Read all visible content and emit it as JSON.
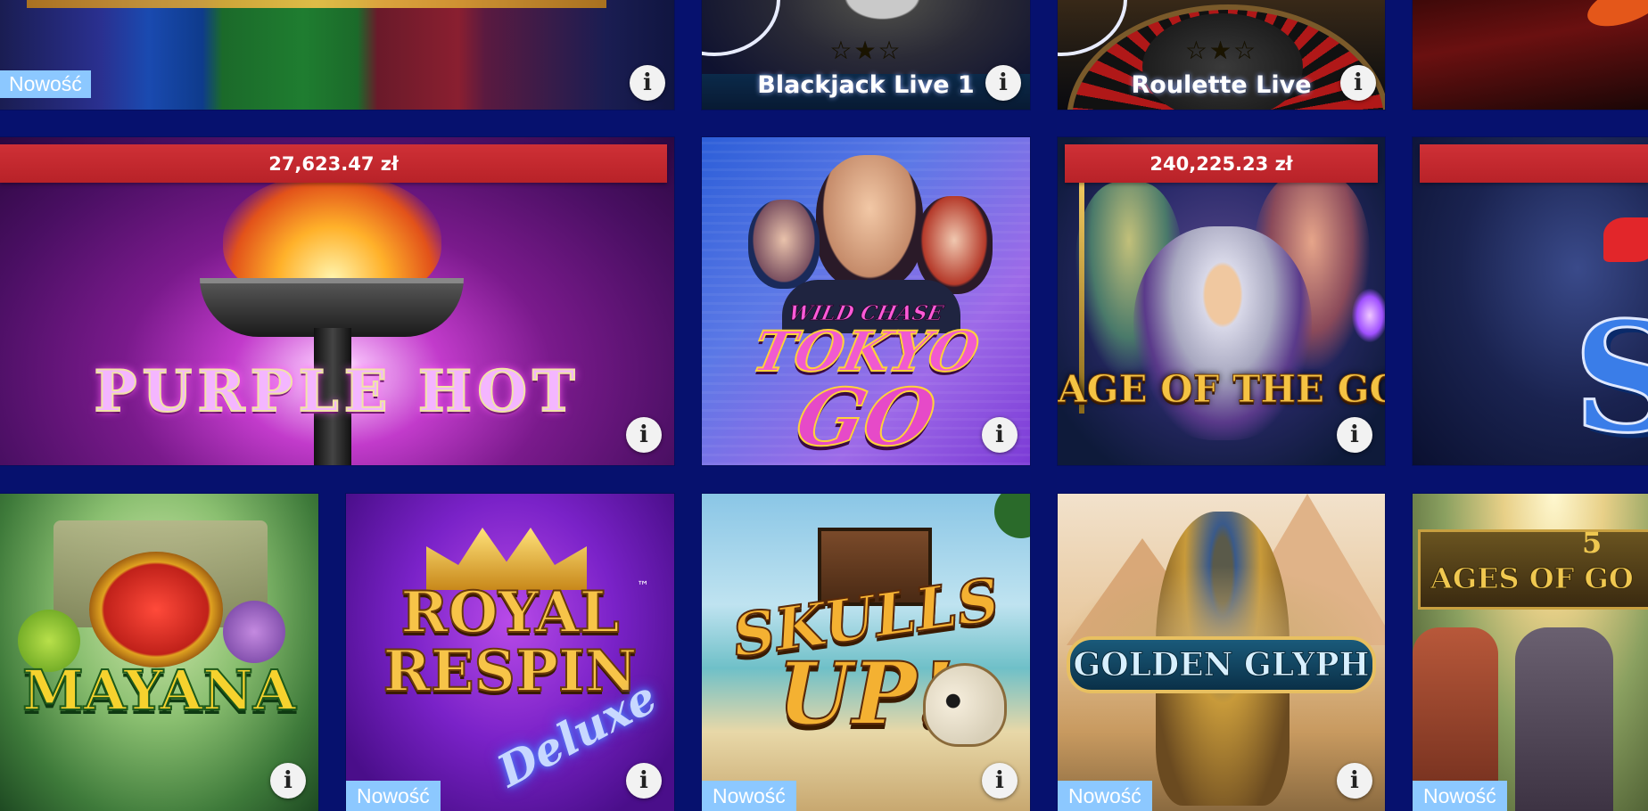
{
  "rows": {
    "top": {
      "tiles": [
        {
          "badge": "Nowość"
        },
        {
          "title": "Blackjack Live 1",
          "stars": "☆★☆"
        },
        {
          "title": "Roulette Live",
          "stars": "☆★☆"
        },
        {}
      ]
    },
    "middle": {
      "tiles": [
        {
          "jackpot": "27,623.47 zł",
          "logo": "PURPLE HOT"
        },
        {
          "logo_top": "WILD CHASE",
          "logo_mid": "TOKYO",
          "logo_bottom": "GO"
        },
        {
          "jackpot": "240,225.23 zł",
          "logo": "AGE OF THE GODS"
        },
        {
          "jackpot": "",
          "logo": "S"
        }
      ]
    },
    "bottom": {
      "tiles": [
        {
          "logo": "MAYANA"
        },
        {
          "badge": "Nowość",
          "logo_top": "ROYAL",
          "logo_mid": "RESPIN",
          "logo_bottom": "Deluxe",
          "tm": "™"
        },
        {
          "badge": "Nowość",
          "logo_top": "SKULLS",
          "logo_bottom": "UP!"
        },
        {
          "badge": "Nowość",
          "logo": "GOLDEN GLYPH"
        },
        {
          "badge": "Nowość",
          "logo_num": "5",
          "logo": "AGES OF GO"
        }
      ]
    }
  },
  "info_glyph": "i",
  "colors": {
    "page_background": "#06116e",
    "jackpot_bar": "#c42a30",
    "new_badge": "#8cc8ff"
  }
}
